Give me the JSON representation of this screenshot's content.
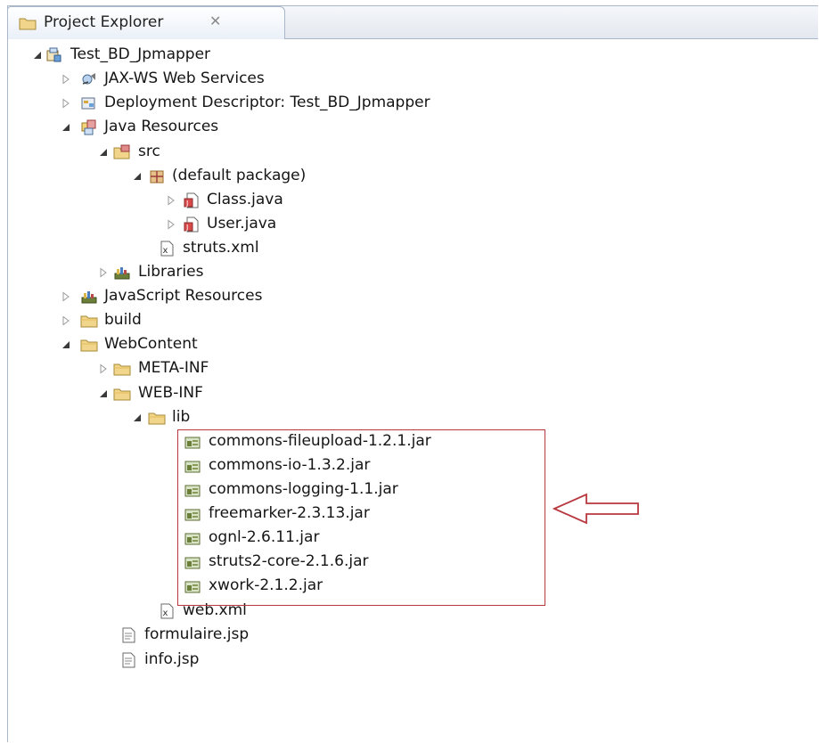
{
  "panel": {
    "title": "Project Explorer",
    "close_glyph": "✕"
  },
  "tree": {
    "items": [
      {
        "label": "Test_BD_Jpmapper",
        "icon": "project-icon",
        "state": "expanded"
      },
      {
        "label": "JAX-WS Web Services",
        "icon": "webservices-icon",
        "state": "collapsed"
      },
      {
        "label": "Deployment Descriptor: Test_BD_Jpmapper",
        "icon": "descriptor-icon",
        "state": "collapsed"
      },
      {
        "label": "Java Resources",
        "icon": "java-resources-icon",
        "state": "expanded"
      },
      {
        "label": "src",
        "icon": "source-folder-icon",
        "state": "expanded"
      },
      {
        "label": "(default package)",
        "icon": "package-icon",
        "state": "expanded"
      },
      {
        "label": "Class.java",
        "icon": "java-file-icon",
        "state": "collapsed"
      },
      {
        "label": "User.java",
        "icon": "java-file-icon",
        "state": "collapsed"
      },
      {
        "label": "struts.xml",
        "icon": "xml-file-icon",
        "state": "leaf"
      },
      {
        "label": "Libraries",
        "icon": "libraries-icon",
        "state": "collapsed"
      },
      {
        "label": "JavaScript Resources",
        "icon": "libraries-icon",
        "state": "collapsed"
      },
      {
        "label": "build",
        "icon": "folder-icon",
        "state": "collapsed"
      },
      {
        "label": "WebContent",
        "icon": "folder-icon",
        "state": "expanded"
      },
      {
        "label": "META-INF",
        "icon": "folder-icon",
        "state": "collapsed"
      },
      {
        "label": "WEB-INF",
        "icon": "folder-icon",
        "state": "expanded"
      },
      {
        "label": "lib",
        "icon": "folder-icon",
        "state": "expanded"
      },
      {
        "label": "commons-fileupload-1.2.1.jar",
        "icon": "jar-icon",
        "state": "leaf"
      },
      {
        "label": "commons-io-1.3.2.jar",
        "icon": "jar-icon",
        "state": "leaf"
      },
      {
        "label": "commons-logging-1.1.jar",
        "icon": "jar-icon",
        "state": "leaf"
      },
      {
        "label": "freemarker-2.3.13.jar",
        "icon": "jar-icon",
        "state": "leaf"
      },
      {
        "label": "ognl-2.6.11.jar",
        "icon": "jar-icon",
        "state": "leaf"
      },
      {
        "label": "struts2-core-2.1.6.jar",
        "icon": "jar-icon",
        "state": "leaf"
      },
      {
        "label": "xwork-2.1.2.jar",
        "icon": "jar-icon",
        "state": "leaf"
      },
      {
        "label": "web.xml",
        "icon": "xml-file-icon",
        "state": "leaf"
      },
      {
        "label": "formulaire.jsp",
        "icon": "jsp-file-icon",
        "state": "leaf"
      },
      {
        "label": "info.jsp",
        "icon": "jsp-file-icon",
        "state": "leaf"
      }
    ]
  },
  "annotation": {
    "highlight_color": "#b8383f",
    "arrow_icon": "left-arrow-icon"
  },
  "colors": {
    "tab_border": "#a9b7c9",
    "folder": "#e8c35a",
    "jar": "#6b7f3a"
  }
}
